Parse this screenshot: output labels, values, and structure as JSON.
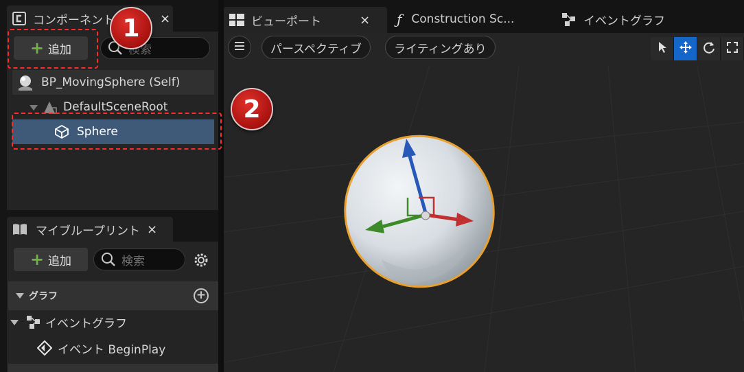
{
  "components_panel": {
    "tab_label": "コンポーネント",
    "close": "×",
    "add_label": "追加",
    "search_placeholder": "検索",
    "tree": [
      {
        "label": "BP_MovingSphere (Self)"
      },
      {
        "label": "DefaultSceneRoot"
      },
      {
        "label": "Sphere"
      }
    ]
  },
  "my_blueprint_panel": {
    "tab_label": "マイブループリント",
    "close": "×",
    "add_label": "追加",
    "search_placeholder": "検索",
    "graph_section": "グラフ",
    "event_graph": "イベントグラフ",
    "event_item": "イベント BeginPlay"
  },
  "editor_tabs": {
    "viewport": "ビューポート",
    "viewport_close": "×",
    "construction_script": "Construction Sc...",
    "event_graph": "イベントグラフ"
  },
  "viewport_toolbar": {
    "perspective": "パースペクティブ",
    "lighting": "ライティングあり"
  },
  "annotations": {
    "badge1": "1",
    "badge2": "2"
  },
  "colors": {
    "add_plus": "#70b342",
    "selected_row": "#3e5a78",
    "active_tool": "#1466c8",
    "annotation_red": "#d0201c",
    "selection_outline": "#e8a030"
  }
}
